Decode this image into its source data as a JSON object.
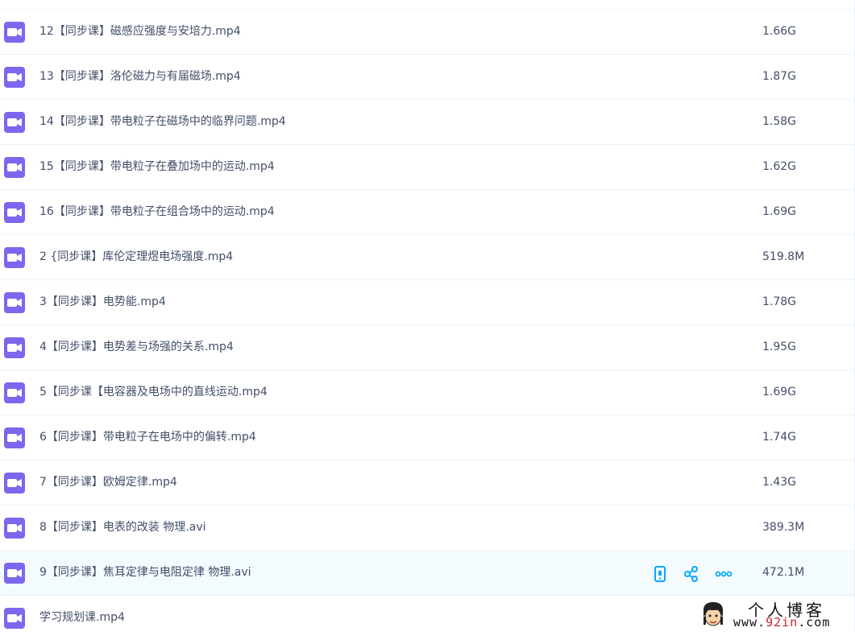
{
  "files": [
    {
      "name": "12【同步课】磁感应强度与安培力.mp4",
      "size": "1.66G"
    },
    {
      "name": "13【同步课】洛伦磁力与有届磁场.mp4",
      "size": "1.87G"
    },
    {
      "name": "14【同步课】带电粒子在磁场中的临界问题.mp4",
      "size": "1.58G"
    },
    {
      "name": "15【同步课】带电粒子在叠加场中的运动.mp4",
      "size": "1.62G"
    },
    {
      "name": "16【同步课】带电粒子在组合场中的运动.mp4",
      "size": "1.69G"
    },
    {
      "name": "2 {同步课】库伦定理煜电场强度.mp4",
      "size": "519.8M"
    },
    {
      "name": "3【同步课】电势能.mp4",
      "size": "1.78G"
    },
    {
      "name": "4【同步课】电势差与场强的关系.mp4",
      "size": "1.95G"
    },
    {
      "name": "5【同步课【电容器及电场中的直线运动.mp4",
      "size": "1.69G"
    },
    {
      "name": "6【同步课】带电粒子在电场中的偏转.mp4",
      "size": "1.74G"
    },
    {
      "name": "7【同步课】欧姆定律.mp4",
      "size": "1.43G"
    },
    {
      "name": "8【同步课】电表的改装 物理.avi",
      "size": "389.3M"
    },
    {
      "name": "9【同步课】焦耳定律与电阻定律 物理.avi",
      "size": "472.1M"
    },
    {
      "name": "学习规划课.mp4",
      "size": ""
    }
  ],
  "hovered_row_actions": [
    "phone-icon",
    "share-icon",
    "more-icon"
  ],
  "icon": "video-file-icon",
  "colors": {
    "video_icon": "#7b68ee",
    "action_icon": "#06a7ff",
    "hover_bg": "#f4fbff",
    "text": "#424e67",
    "watermark_red": "#d0202a"
  },
  "watermark": {
    "title": "个人博客",
    "url_prefix": "www.",
    "url_highlight": "92in",
    "url_suffix": ".com"
  }
}
